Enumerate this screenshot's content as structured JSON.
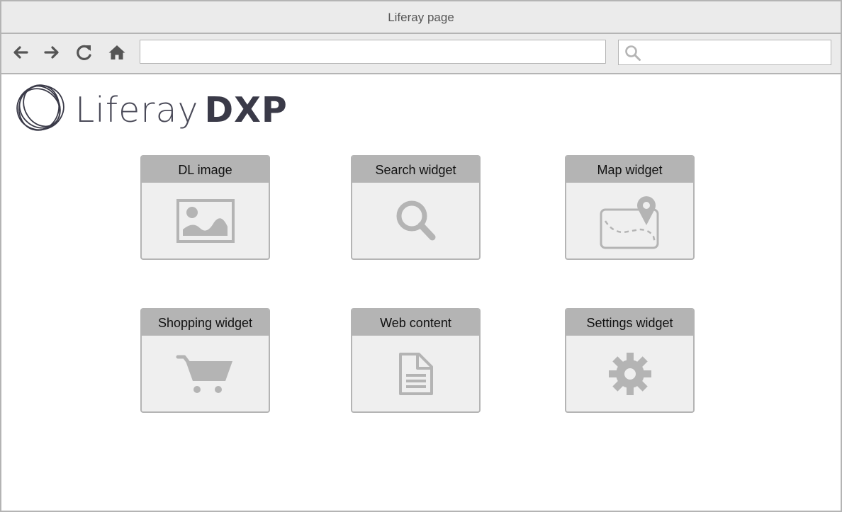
{
  "window": {
    "title": "Liferay page"
  },
  "toolbar": {
    "back_icon": "arrow-left-icon",
    "forward_icon": "arrow-right-icon",
    "reload_icon": "reload-icon",
    "home_icon": "home-icon",
    "url_value": "",
    "search_value": "",
    "search_icon": "search-icon"
  },
  "logo": {
    "text_light": "Liferay",
    "text_bold": "DXP"
  },
  "widgets": [
    {
      "label": "DL image",
      "icon": "image-icon"
    },
    {
      "label": "Search widget",
      "icon": "search-icon"
    },
    {
      "label": "Map widget",
      "icon": "map-icon"
    },
    {
      "label": "Shopping widget",
      "icon": "shopping-cart-icon"
    },
    {
      "label": "Web content",
      "icon": "document-icon"
    },
    {
      "label": "Settings widget",
      "icon": "gear-icon"
    }
  ],
  "colors": {
    "chrome": "#ebebeb",
    "border": "#b4b4b4",
    "widget_header": "#b4b4b4",
    "widget_body": "#efefef",
    "icon": "#b4b4b4",
    "logo_text": "#3a3a48"
  }
}
